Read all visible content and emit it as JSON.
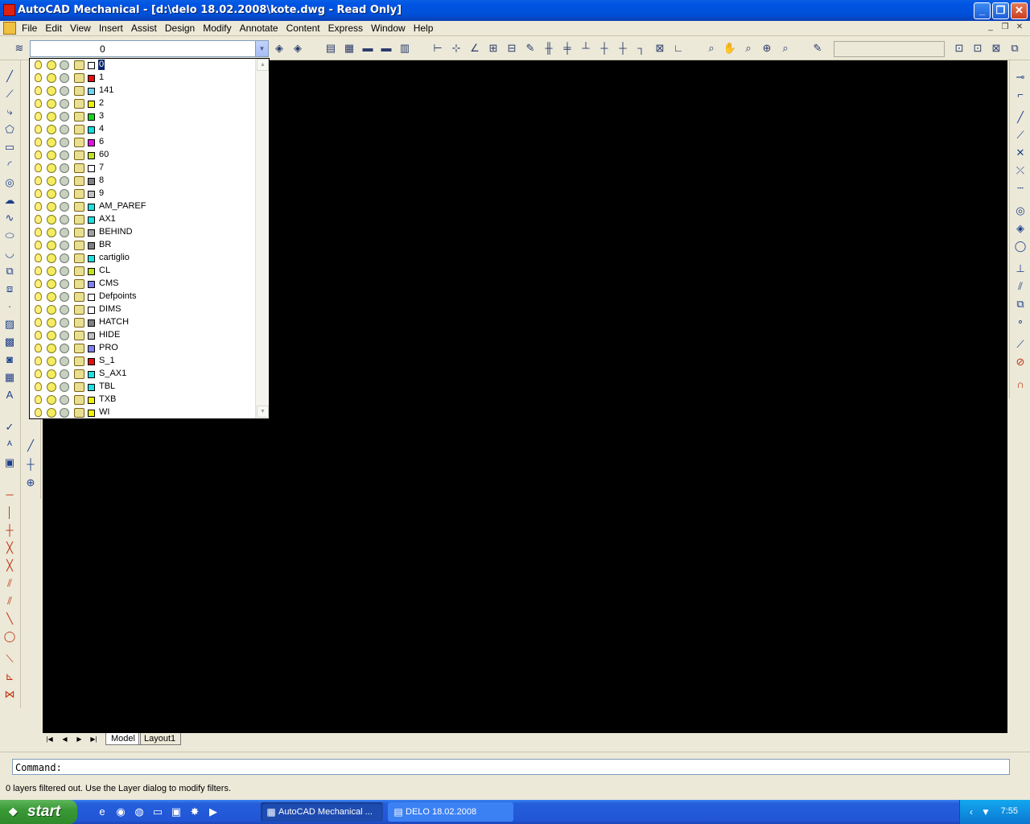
{
  "window": {
    "title": "AutoCAD Mechanical - [d:\\delo 18.02.2008\\kote.dwg - Read Only]"
  },
  "menu": [
    "File",
    "Edit",
    "View",
    "Insert",
    "Assist",
    "Design",
    "Modify",
    "Annotate",
    "Content",
    "Express",
    "Window",
    "Help"
  ],
  "layer_combo": {
    "current": "0"
  },
  "layers": [
    {
      "name": "0",
      "color": "#ffffff",
      "selected": true
    },
    {
      "name": "1",
      "color": "#e01010"
    },
    {
      "name": "141",
      "color": "#70d0f0"
    },
    {
      "name": "2",
      "color": "#f0f000"
    },
    {
      "name": "3",
      "color": "#20d020"
    },
    {
      "name": "4",
      "color": "#10e0e0"
    },
    {
      "name": "6",
      "color": "#e010e0"
    },
    {
      "name": "60",
      "color": "#c0e020"
    },
    {
      "name": "7",
      "color": "#ffffff"
    },
    {
      "name": "8",
      "color": "#808080"
    },
    {
      "name": "9",
      "color": "#c0c0c0"
    },
    {
      "name": "AM_PAREF",
      "color": "#20e0e0"
    },
    {
      "name": "AX1",
      "color": "#20e0e0"
    },
    {
      "name": "BEHIND",
      "color": "#a0a0a0"
    },
    {
      "name": "BR",
      "color": "#808080"
    },
    {
      "name": "cartiglio",
      "color": "#20e0e0"
    },
    {
      "name": "CL",
      "color": "#c0e020"
    },
    {
      "name": "CMS",
      "color": "#8080f0"
    },
    {
      "name": "Defpoints",
      "color": "#ffffff"
    },
    {
      "name": "DIMS",
      "color": "#ffffff"
    },
    {
      "name": "HATCH",
      "color": "#808080"
    },
    {
      "name": "HIDE",
      "color": "#c0c0c0"
    },
    {
      "name": "PRO",
      "color": "#8080f0"
    },
    {
      "name": "S_1",
      "color": "#e01010"
    },
    {
      "name": "S_AX1",
      "color": "#20e0e0"
    },
    {
      "name": "TBL",
      "color": "#20e0e0"
    },
    {
      "name": "TXB",
      "color": "#f0f000"
    },
    {
      "name": "WI",
      "color": "#f0f000"
    }
  ],
  "tabs": {
    "model": "Model",
    "layout1": "Layout1"
  },
  "command": {
    "prompt": "Command:"
  },
  "status": {
    "message": "0 layers filtered out.  Use the Layer dialog to modify filters."
  },
  "taskbar": {
    "start": "start",
    "tasks": [
      "AutoCAD Mechanical ...",
      "DELO 18.02.2008"
    ],
    "clock": "7:55"
  }
}
